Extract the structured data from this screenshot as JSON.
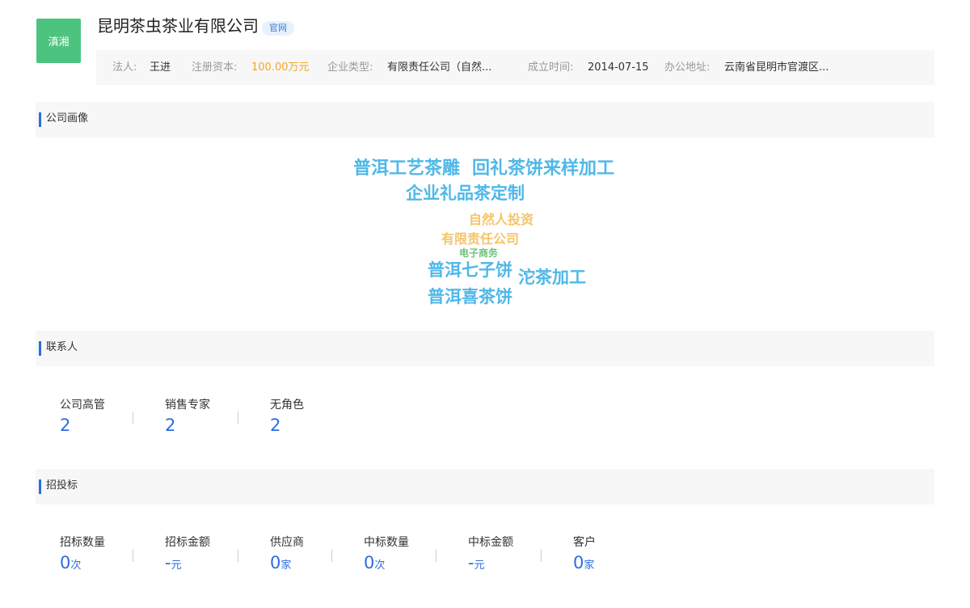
{
  "company": {
    "logo_text": "滇湘",
    "name": "昆明茶虫茶业有限公司",
    "official_site_badge": "官网"
  },
  "info": {
    "legal_person_label": "法人:",
    "legal_person": "王进",
    "capital_label": "注册资本:",
    "capital": "100.00万元",
    "type_label": "企业类型:",
    "type": "有限责任公司（自然...",
    "founded_label": "成立时间:",
    "founded": "2014-07-15",
    "address_label": "办公地址:",
    "address": "云南省昆明市官渡区..."
  },
  "portrait": {
    "title": "公司画像",
    "words": [
      {
        "text": "普洱工艺茶雕",
        "color": "#4fb8e8"
      },
      {
        "text": "回礼茶饼来样加工",
        "color": "#4fb8e8"
      },
      {
        "text": "企业礼品茶定制",
        "color": "#4fb8e8"
      },
      {
        "text": "自然人投资",
        "color": "#f5c469"
      },
      {
        "text": "有限责任公司",
        "color": "#f5c469"
      },
      {
        "text": "电子商务",
        "color": "#6cc47a"
      },
      {
        "text": "普洱七子饼",
        "color": "#4fb8e8"
      },
      {
        "text": "沱茶加工",
        "color": "#4fb8e8"
      },
      {
        "text": "普洱喜茶饼",
        "color": "#4fb8e8"
      }
    ]
  },
  "contacts": {
    "title": "联系人",
    "stats": [
      {
        "label": "公司高管",
        "value": "2"
      },
      {
        "label": "销售专家",
        "value": "2"
      },
      {
        "label": "无角色",
        "value": "2"
      }
    ]
  },
  "bidding": {
    "title": "招投标",
    "stats": [
      {
        "label": "招标数量",
        "value": "0",
        "unit": "次"
      },
      {
        "label": "招标金额",
        "value": "-",
        "unit": "元"
      },
      {
        "label": "供应商",
        "value": "0",
        "unit": "家"
      },
      {
        "label": "中标数量",
        "value": "0",
        "unit": "次"
      },
      {
        "label": "中标金额",
        "value": "-",
        "unit": "元"
      },
      {
        "label": "客户",
        "value": "0",
        "unit": "家"
      }
    ]
  },
  "colors": {
    "accent": "#2d6cdf",
    "logo_bg": "#4cc47f",
    "capital": "#f5a623"
  }
}
